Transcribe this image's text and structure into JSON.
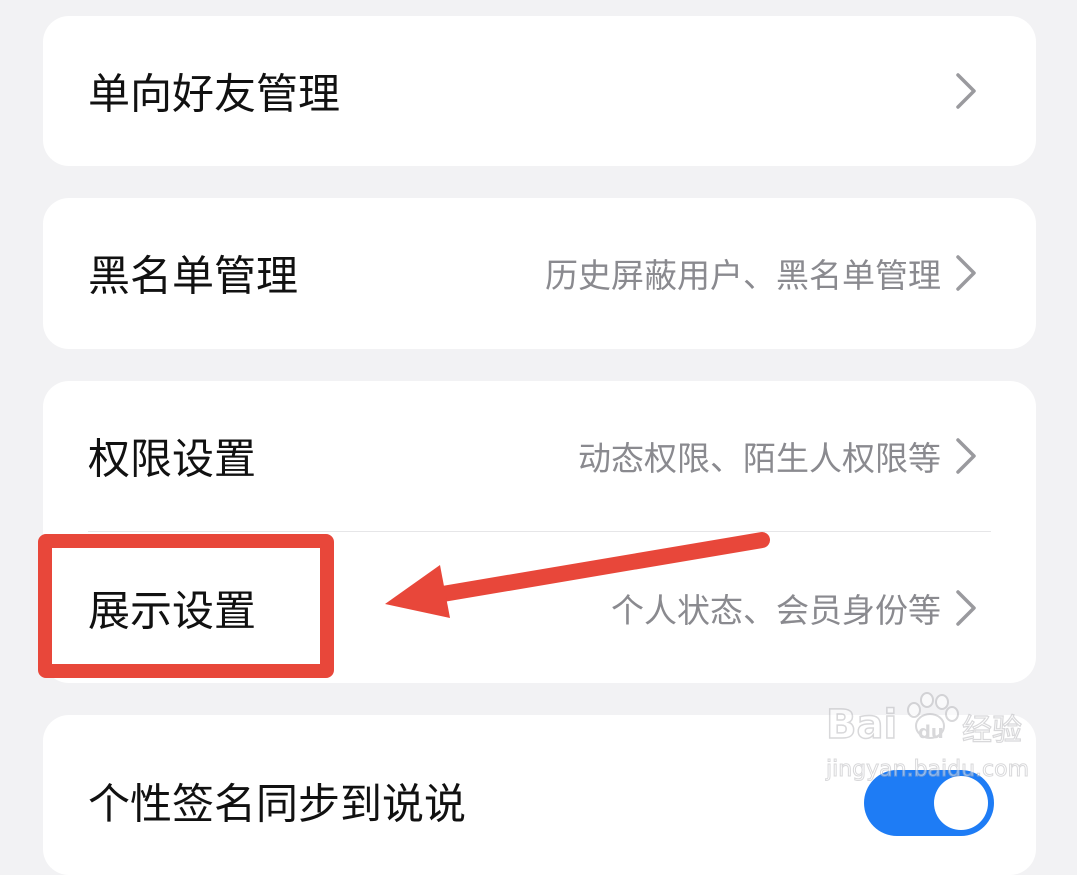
{
  "settings": {
    "items": [
      {
        "title": "单向好友管理",
        "subtitle": ""
      },
      {
        "title": "黑名单管理",
        "subtitle": "历史屏蔽用户、黑名单管理"
      },
      {
        "title": "权限设置",
        "subtitle": "动态权限、陌生人权限等"
      },
      {
        "title": "展示设置",
        "subtitle": "个人状态、会员身份等"
      },
      {
        "title": "个性签名同步到说说",
        "toggle_on": true
      }
    ]
  },
  "annotation": {
    "highlighted_item": "展示设置",
    "color": "#e8473a"
  },
  "watermark": {
    "logo_text": "Bai du 经验",
    "url_text": "jingyan.baidu.com"
  },
  "colors": {
    "background": "#f2f2f4",
    "card": "#ffffff",
    "toggle_accent": "#1e7cf5",
    "subtitle": "#8a8a8f"
  }
}
